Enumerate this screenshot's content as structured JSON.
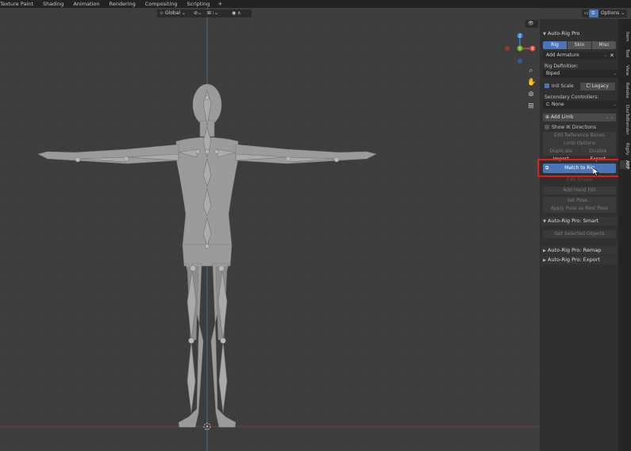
{
  "workspace_tabs": [
    "Texture Paint",
    "Shading",
    "Animation",
    "Rendering",
    "Compositing",
    "Scripting"
  ],
  "add_tab_symbol": "+",
  "header": {
    "transform_orientation": "Global",
    "options_label": "Options"
  },
  "gizmo_axes": {
    "x": "X",
    "y": "Y",
    "z": "Z"
  },
  "sidebar_tabs": [
    "Item",
    "Tool",
    "View",
    "Rokoko",
    "DazToBlender",
    "Rigify",
    "ARP"
  ],
  "panel": {
    "title": "Auto-Rig Pro",
    "tabs": [
      "Rig",
      "Skin",
      "Misc"
    ],
    "add_armature": "Add Armature",
    "rig_definition_label": "Rig Definition:",
    "rig_definition_value": "Biped",
    "init_scale": "Init Scale",
    "legacy": "Legacy",
    "secondary_controllers_label": "Secondary Controllers:",
    "secondary_controllers_value": "None",
    "add_limb": "Add Limb",
    "show_ik_directions": "Show IK Directions",
    "edit_reference_bones": "Edit Reference Bones",
    "limb_options": "Limb Options",
    "duplicate": "Duplicate",
    "disable": "Disable",
    "import": "Import",
    "export": "Export",
    "match_to_rig": "Match to Rig",
    "edit_shape": "Edit Shape",
    "add_hand_fist": "Add Hand Fist",
    "set_pose": "Set Pose...",
    "apply_pose_rest": "Apply Pose as Rest Pose"
  },
  "sections": {
    "smart": "Auto-Rig Pro: Smart",
    "get_selected_objects": "Get Selected Objects",
    "remap": "Auto-Rig Pro: Remap",
    "export": "Auto-Rig Pro: Export"
  },
  "colors": {
    "accent": "#4a75b8",
    "highlight": "#e21b1b",
    "axis_red": "#e0503f",
    "axis_green": "#6bb326",
    "axis_blue": "#3b83d6"
  }
}
